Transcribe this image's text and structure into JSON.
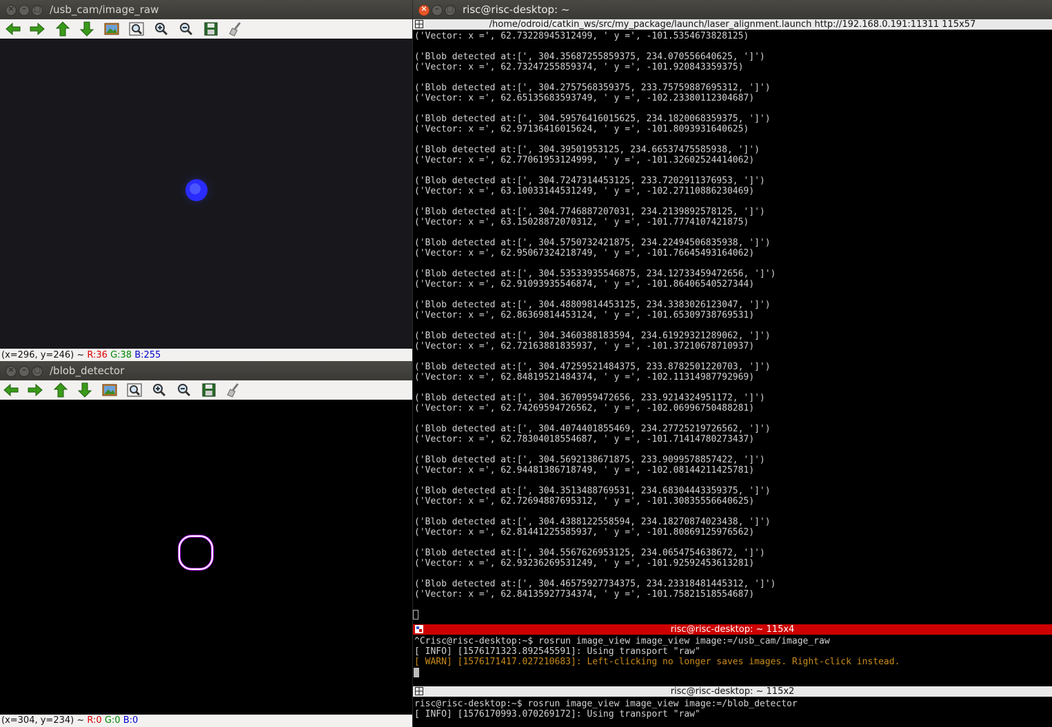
{
  "window1": {
    "title": "/usb_cam/image_raw",
    "status_prefix": "(x=296, y=246) ~ ",
    "status_r": "R:36",
    "status_g": "G:38",
    "status_b": "B:255"
  },
  "window2": {
    "title": "/blob_detector",
    "status_prefix": "(x=304, y=234) ~ ",
    "status_r": "R:0",
    "status_g": "G:0",
    "status_b": "B:0"
  },
  "toolbar_icons": [
    "back-icon",
    "forward-icon",
    "up-icon",
    "down-icon",
    "image-icon",
    "zoom-fit-icon",
    "zoom-in-icon",
    "zoom-out-icon",
    "save-icon",
    "clear-icon"
  ],
  "terminal_main": {
    "title": "risc@risc-desktop: ~",
    "header": "/home/odroid/catkin_ws/src/my_package/launch/laser_alignment.launch http://192.168.0.191:11311 115x57",
    "lines": [
      "('Vector: x =', 62.73228945312499, ' y =', -101.5354673828125)",
      "",
      "('Blob detected at:[', 304.35687255859375, 234.070556640625, ']')",
      "('Vector: x =', 62.73247255859374, ' y =', -101.920843359375)",
      "",
      "('Blob detected at:[', 304.2757568359375, 233.75759887695312, ']')",
      "('Vector: x =', 62.65135683593749, ' y =', -102.23380112304687)",
      "",
      "('Blob detected at:[', 304.59576416015625, 234.1820068359375, ']')",
      "('Vector: x =', 62.97136416015624, ' y =', -101.8093931640625)",
      "",
      "('Blob detected at:[', 304.39501953125, 234.66537475585938, ']')",
      "('Vector: x =', 62.77061953124999, ' y =', -101.32602524414062)",
      "",
      "('Blob detected at:[', 304.7247314453125, 233.7202911376953, ']')",
      "('Vector: x =', 63.10033144531249, ' y =', -102.27110886230469)",
      "",
      "('Blob detected at:[', 304.7746887207031, 234.2139892578125, ']')",
      "('Vector: x =', 63.15028872070312, ' y =', -101.7774107421875)",
      "",
      "('Blob detected at:[', 304.5750732421875, 234.22494506835938, ']')",
      "('Vector: x =', 62.95067324218749, ' y =', -101.76645493164062)",
      "",
      "('Blob detected at:[', 304.53533935546875, 234.12733459472656, ']')",
      "('Vector: x =', 62.91093935546874, ' y =', -101.86406540527344)",
      "",
      "('Blob detected at:[', 304.48809814453125, 234.3383026123047, ']')",
      "('Vector: x =', 62.86369814453124, ' y =', -101.65309738769531)",
      "",
      "('Blob detected at:[', 304.3460388183594, 234.61929321289062, ']')",
      "('Vector: x =', 62.72163881835937, ' y =', -101.37210678710937)",
      "",
      "('Blob detected at:[', 304.47259521484375, 233.8782501220703, ']')",
      "('Vector: x =', 62.84819521484374, ' y =', -102.11314987792969)",
      "",
      "('Blob detected at:[', 304.3670959472656, 233.9214324951172, ']')",
      "('Vector: x =', 62.74269594726562, ' y =', -102.06996750488281)",
      "",
      "('Blob detected at:[', 304.4074401855469, 234.27725219726562, ']')",
      "('Vector: x =', 62.78304018554687, ' y =', -101.71414780273437)",
      "",
      "('Blob detected at:[', 304.5692138671875, 233.9099578857422, ']')",
      "('Vector: x =', 62.94481386718749, ' y =', -102.08144211425781)",
      "",
      "('Blob detected at:[', 304.3513488769531, 234.68304443359375, ']')",
      "('Vector: x =', 62.72694887695312, ' y =', -101.30835556640625)",
      "",
      "('Blob detected at:[', 304.4388122558594, 234.18270874023438, ']')",
      "('Vector: x =', 62.81441225585937, ' y =', -101.80869125976562)",
      "",
      "('Blob detected at:[', 304.5567626953125, 234.0654754638672, ']')",
      "('Vector: x =', 62.93236269531249, ' y =', -101.92592453613281)",
      "",
      "('Blob detected at:[', 304.46575927734375, 234.23318481445312, ']')",
      "('Vector: x =', 62.84135927734374, ' y =', -101.75821518554687)"
    ]
  },
  "terminal_mid": {
    "header": "risc@risc-desktop: ~ 115x4",
    "line1": "^Crisc@risc-desktop:~$ rosrun image_view image_view image:=/usb_cam/image_raw",
    "line2": "[ INFO] [1576171323.892545591]: Using transport \"raw\"",
    "line3": "[ WARN] [1576171417.027210683]: Left-clicking no longer saves images. Right-click instead."
  },
  "terminal_bottom": {
    "header": "risc@risc-desktop: ~ 115x2",
    "line1": "risc@risc-desktop:~$ rosrun image_view image_view image:=/blob_detector",
    "line2": "[ INFO] [1576170993.070269172]: Using transport \"raw\""
  },
  "colors": {
    "blob": "#2a2bff",
    "detector_ring": "#ffffff",
    "detector_ring_edge": "#c020ff",
    "terminal_bg": "#000000",
    "active_header": "#cc0000",
    "warn_text": "#c88b1a"
  }
}
